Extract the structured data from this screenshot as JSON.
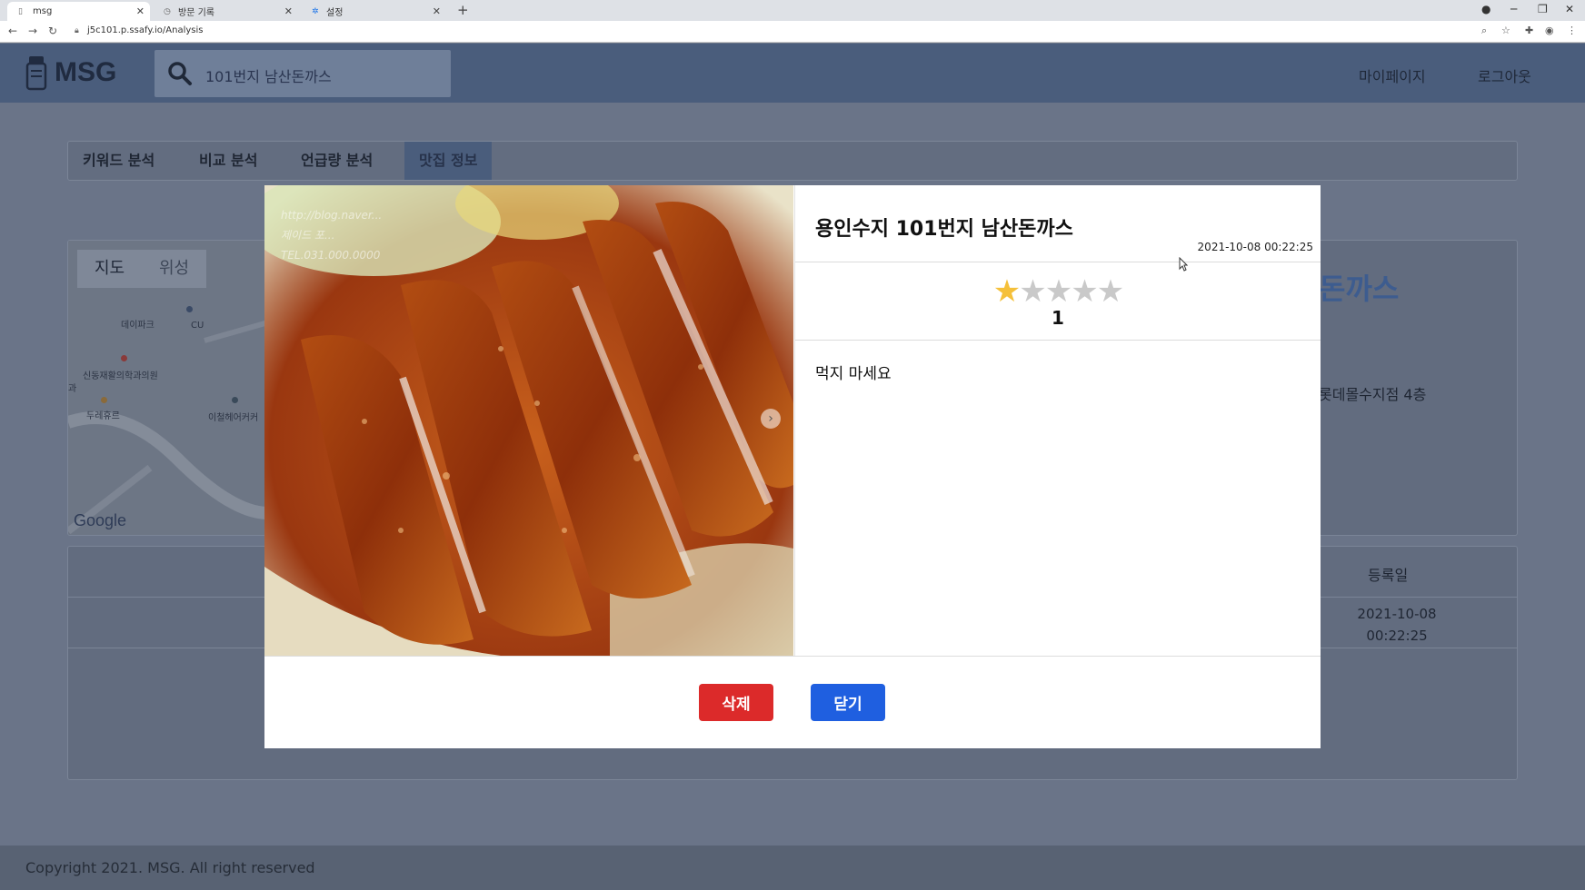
{
  "browser": {
    "tabs": [
      {
        "title": "msg",
        "icon": "msg-favicon-icon"
      },
      {
        "title": "방문 기록",
        "icon": "history-icon"
      },
      {
        "title": "설정",
        "icon": "settings-gear-icon"
      }
    ],
    "url": "j5c101.p.ssafy.io/Analysis"
  },
  "header": {
    "logo_text": "MSG",
    "search_value": "101번지 남산돈까스",
    "nav": {
      "mypage": "마이페이지",
      "logout": "로그아웃"
    }
  },
  "page_tabs": [
    "키워드 분석",
    "비교 분석",
    "언급량 분석",
    "맛집 정보"
  ],
  "map": {
    "buttons": [
      "지도",
      "위성"
    ],
    "labels": [
      "데이파크",
      "CU",
      "신동재활의학과의원",
      "두레휴르",
      "이철헤어커커",
      "과"
    ],
    "google": "Google"
  },
  "store_bg": {
    "title_partial": "돈까스",
    "address_partial": "롯데몰수지점 4층"
  },
  "review_table": {
    "date_header": "등록일",
    "row": {
      "date": "2021-10-08",
      "time": "00:22:25"
    }
  },
  "footer": {
    "copyright": "Copyright 2021. MSG. All right reserved"
  },
  "modal": {
    "store_title": "용인수지 101번지 남산돈까스",
    "date": "2021-10-08 00:22:25",
    "rating": 1,
    "rating_max": 5,
    "rating_label": "1",
    "content": "먹지 마세요",
    "photo_watermark": [
      "http://blog.naver...",
      "제이드 포...",
      "TEL.031.000.0000"
    ],
    "buttons": {
      "delete": "삭제",
      "close": "닫기"
    },
    "colors": {
      "delete": "#dc2a2a",
      "close": "#1f5fe0",
      "star": "#f5c03a"
    }
  }
}
